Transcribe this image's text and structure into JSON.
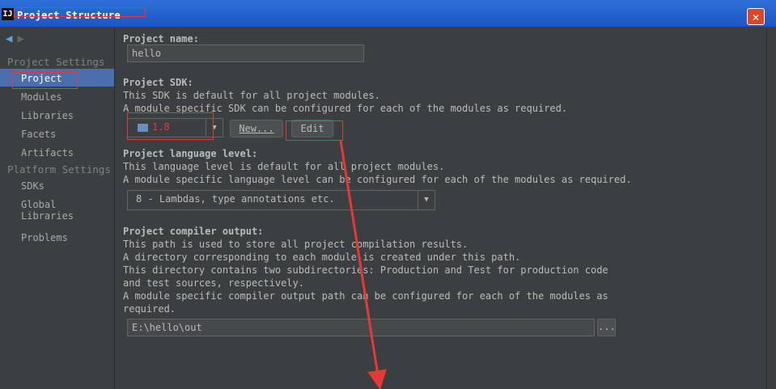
{
  "window": {
    "title": "Project Structure",
    "app_icon": "intellij-icon",
    "close_glyph": "✕"
  },
  "sidebar": {
    "project_settings_header": "Project Settings",
    "project_settings_items": [
      "Project",
      "Modules",
      "Libraries",
      "Facets",
      "Artifacts"
    ],
    "platform_settings_header": "Platform Settings",
    "platform_settings_items": [
      "SDKs",
      "Global Libraries"
    ],
    "problems": "Problems",
    "selected": "Project"
  },
  "content": {
    "name_label": "Project name:",
    "name_value": "hello",
    "sdk_label": "Project SDK:",
    "sdk_desc1": "This SDK is default for all project modules.",
    "sdk_desc2": "A module specific SDK can be configured for each of the modules as required.",
    "sdk_value": "1.8",
    "new_button": "New...",
    "edit_button": "Edit",
    "lang_label": "Project language level:",
    "lang_desc1": "This language level is default for all project modules.",
    "lang_desc2": "A module specific language level can be configured for each of the modules as required.",
    "lang_value": "8 - Lambdas, type annotations etc.",
    "out_label": "Project compiler output:",
    "out_desc": [
      "This path is used to store all project compilation results.",
      "A directory corresponding to each module is created under this path.",
      "This directory contains two subdirectories: Production and Test for production code",
      "and test sources, respectively.",
      "A module specific compiler output path can be configured for each of the modules as",
      "required."
    ],
    "out_value": "E:\\hello\\out",
    "browse_button": "..."
  },
  "annotation_color": "#e53935"
}
